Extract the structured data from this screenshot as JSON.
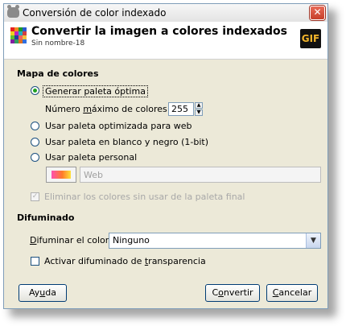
{
  "window": {
    "title": "Conversión de color indexado",
    "close_label": "✕"
  },
  "header": {
    "title": "Convertir la imagen a colores indexados",
    "subtitle": "Sin nombre-18",
    "badge": "GIF"
  },
  "colormap": {
    "section_title": "Mapa de colores",
    "optimal": {
      "label": "Generar paleta óptima",
      "checked": true
    },
    "max_colors": {
      "label_pre": "Número ",
      "label_mnemonic": "m",
      "label_post": "áximo de colores:",
      "value": "255"
    },
    "web": {
      "label": "Usar paleta optimizada para web",
      "checked": false
    },
    "bw": {
      "label": "Usar paleta en blanco y negro (1-bit)",
      "checked": false
    },
    "custom": {
      "label": "Usar paleta personal",
      "checked": false
    },
    "palette_name": "Web",
    "remove_unused": {
      "label": "Eliminar los colores sin usar de la paleta final",
      "checked": true,
      "disabled": true
    }
  },
  "dither": {
    "section_title": "Difuminado",
    "color_label_mnemonic": "D",
    "color_label_rest": "ifuminar el color:",
    "color_value": "Ninguno",
    "transparency": {
      "label_pre": "Activar difuminado de ",
      "label_mnemonic": "t",
      "label_post": "ransparencia",
      "checked": false
    }
  },
  "buttons": {
    "help": {
      "pre": "Ay",
      "mnemonic": "u",
      "post": "da"
    },
    "convert": {
      "pre": "C",
      "mnemonic": "o",
      "post": "nvertir"
    },
    "cancel": {
      "pre": "",
      "mnemonic": "C",
      "post": "ancelar"
    }
  },
  "colors": {
    "accent_green": "#21a121",
    "button_border": "#003c74",
    "badge_yellow": "#f3b52b"
  }
}
